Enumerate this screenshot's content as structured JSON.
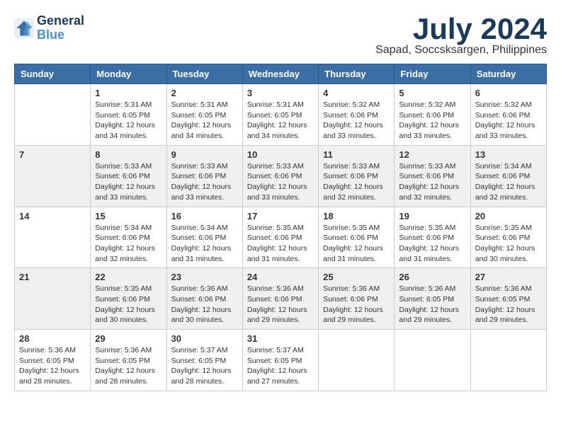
{
  "logo": {
    "line1": "General",
    "line2": "Blue"
  },
  "title": "July 2024",
  "subtitle": "Sapad, Soccsksargen, Philippines",
  "weekdays": [
    "Sunday",
    "Monday",
    "Tuesday",
    "Wednesday",
    "Thursday",
    "Friday",
    "Saturday"
  ],
  "weeks": [
    [
      {
        "day": "",
        "info": ""
      },
      {
        "day": "1",
        "info": "Sunrise: 5:31 AM\nSunset: 6:05 PM\nDaylight: 12 hours\nand 34 minutes."
      },
      {
        "day": "2",
        "info": "Sunrise: 5:31 AM\nSunset: 6:05 PM\nDaylight: 12 hours\nand 34 minutes."
      },
      {
        "day": "3",
        "info": "Sunrise: 5:31 AM\nSunset: 6:05 PM\nDaylight: 12 hours\nand 34 minutes."
      },
      {
        "day": "4",
        "info": "Sunrise: 5:32 AM\nSunset: 6:06 PM\nDaylight: 12 hours\nand 33 minutes."
      },
      {
        "day": "5",
        "info": "Sunrise: 5:32 AM\nSunset: 6:06 PM\nDaylight: 12 hours\nand 33 minutes."
      },
      {
        "day": "6",
        "info": "Sunrise: 5:32 AM\nSunset: 6:06 PM\nDaylight: 12 hours\nand 33 minutes."
      }
    ],
    [
      {
        "day": "7",
        "info": ""
      },
      {
        "day": "8",
        "info": "Sunrise: 5:33 AM\nSunset: 6:06 PM\nDaylight: 12 hours\nand 33 minutes."
      },
      {
        "day": "9",
        "info": "Sunrise: 5:33 AM\nSunset: 6:06 PM\nDaylight: 12 hours\nand 33 minutes."
      },
      {
        "day": "10",
        "info": "Sunrise: 5:33 AM\nSunset: 6:06 PM\nDaylight: 12 hours\nand 33 minutes."
      },
      {
        "day": "11",
        "info": "Sunrise: 5:33 AM\nSunset: 6:06 PM\nDaylight: 12 hours\nand 32 minutes."
      },
      {
        "day": "12",
        "info": "Sunrise: 5:33 AM\nSunset: 6:06 PM\nDaylight: 12 hours\nand 32 minutes."
      },
      {
        "day": "13",
        "info": "Sunrise: 5:34 AM\nSunset: 6:06 PM\nDaylight: 12 hours\nand 32 minutes."
      }
    ],
    [
      {
        "day": "14",
        "info": ""
      },
      {
        "day": "15",
        "info": "Sunrise: 5:34 AM\nSunset: 6:06 PM\nDaylight: 12 hours\nand 32 minutes."
      },
      {
        "day": "16",
        "info": "Sunrise: 5:34 AM\nSunset: 6:06 PM\nDaylight: 12 hours\nand 31 minutes."
      },
      {
        "day": "17",
        "info": "Sunrise: 5:35 AM\nSunset: 6:06 PM\nDaylight: 12 hours\nand 31 minutes."
      },
      {
        "day": "18",
        "info": "Sunrise: 5:35 AM\nSunset: 6:06 PM\nDaylight: 12 hours\nand 31 minutes."
      },
      {
        "day": "19",
        "info": "Sunrise: 5:35 AM\nSunset: 6:06 PM\nDaylight: 12 hours\nand 31 minutes."
      },
      {
        "day": "20",
        "info": "Sunrise: 5:35 AM\nSunset: 6:06 PM\nDaylight: 12 hours\nand 30 minutes."
      }
    ],
    [
      {
        "day": "21",
        "info": ""
      },
      {
        "day": "22",
        "info": "Sunrise: 5:35 AM\nSunset: 6:06 PM\nDaylight: 12 hours\nand 30 minutes."
      },
      {
        "day": "23",
        "info": "Sunrise: 5:36 AM\nSunset: 6:06 PM\nDaylight: 12 hours\nand 30 minutes."
      },
      {
        "day": "24",
        "info": "Sunrise: 5:36 AM\nSunset: 6:06 PM\nDaylight: 12 hours\nand 29 minutes."
      },
      {
        "day": "25",
        "info": "Sunrise: 5:36 AM\nSunset: 6:06 PM\nDaylight: 12 hours\nand 29 minutes."
      },
      {
        "day": "26",
        "info": "Sunrise: 5:36 AM\nSunset: 6:05 PM\nDaylight: 12 hours\nand 29 minutes."
      },
      {
        "day": "27",
        "info": "Sunrise: 5:36 AM\nSunset: 6:05 PM\nDaylight: 12 hours\nand 29 minutes."
      }
    ],
    [
      {
        "day": "28",
        "info": "Sunrise: 5:36 AM\nSunset: 6:05 PM\nDaylight: 12 hours\nand 28 minutes."
      },
      {
        "day": "29",
        "info": "Sunrise: 5:36 AM\nSunset: 6:05 PM\nDaylight: 12 hours\nand 28 minutes."
      },
      {
        "day": "30",
        "info": "Sunrise: 5:37 AM\nSunset: 6:05 PM\nDaylight: 12 hours\nand 28 minutes."
      },
      {
        "day": "31",
        "info": "Sunrise: 5:37 AM\nSunset: 6:05 PM\nDaylight: 12 hours\nand 27 minutes."
      },
      {
        "day": "",
        "info": ""
      },
      {
        "day": "",
        "info": ""
      },
      {
        "day": "",
        "info": ""
      }
    ]
  ]
}
